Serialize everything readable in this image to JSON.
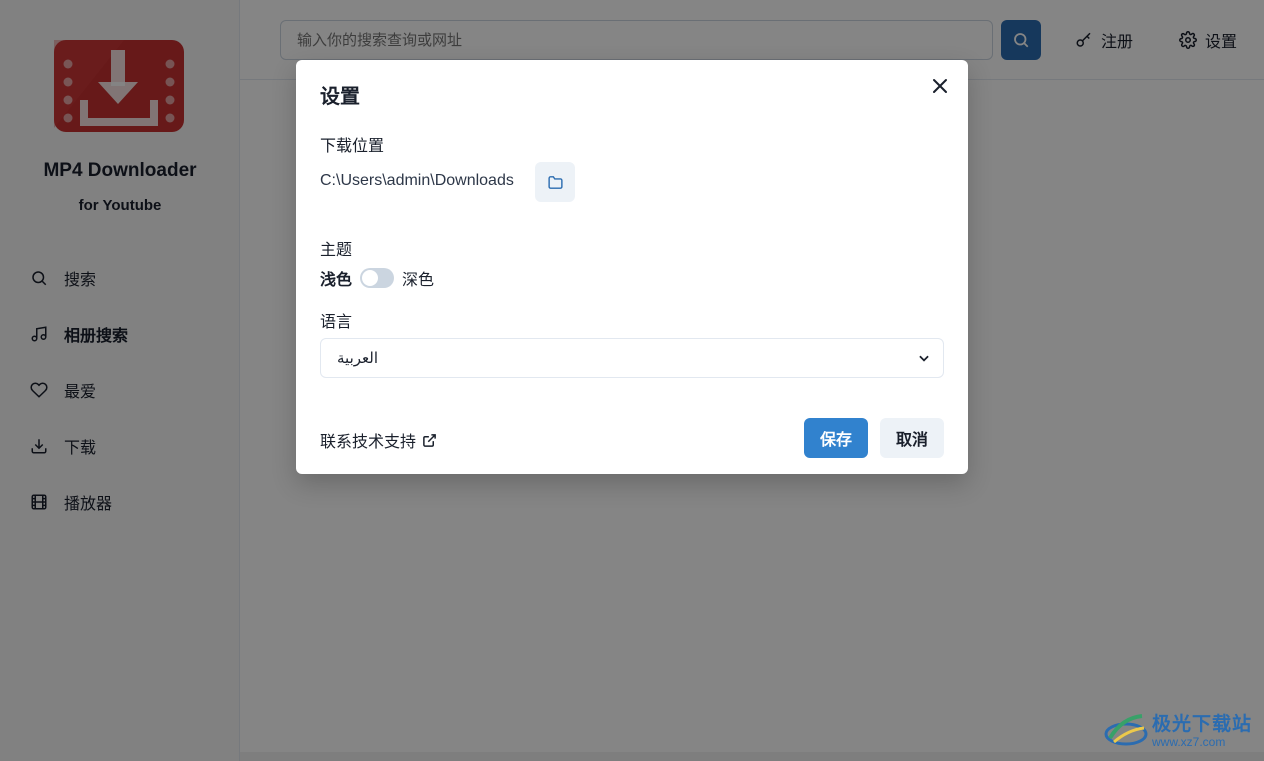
{
  "app": {
    "name": "MP4 Downloader",
    "subtitle": "for Youtube"
  },
  "sidebar": {
    "items": [
      {
        "label": "搜索",
        "icon": "search-icon"
      },
      {
        "label": "相册搜索",
        "icon": "music-note-icon",
        "active": true
      },
      {
        "label": "最爱",
        "icon": "heart-icon"
      },
      {
        "label": "下载",
        "icon": "download-icon"
      },
      {
        "label": "播放器",
        "icon": "film-icon"
      }
    ]
  },
  "header": {
    "search_placeholder": "输入你的搜索查询或网址",
    "register_label": "注册",
    "settings_label": "设置"
  },
  "modal": {
    "title": "设置",
    "download_location_label": "下载位置",
    "download_path": "C:\\Users\\admin\\Downloads",
    "theme_label": "主题",
    "theme_light": "浅色",
    "theme_dark": "深色",
    "theme_dark_enabled": false,
    "language_label": "语言",
    "language_value": "العربية",
    "support_link": "联系技术支持",
    "save_label": "保存",
    "cancel_label": "取消"
  },
  "watermark": {
    "name": "极光下载站",
    "url": "www.xz7.com"
  },
  "colors": {
    "primary": "#3182ce",
    "search_button": "#2b6cb0",
    "logo_red": "#c53030",
    "overlay": "rgba(0,0,0,0.48)"
  }
}
